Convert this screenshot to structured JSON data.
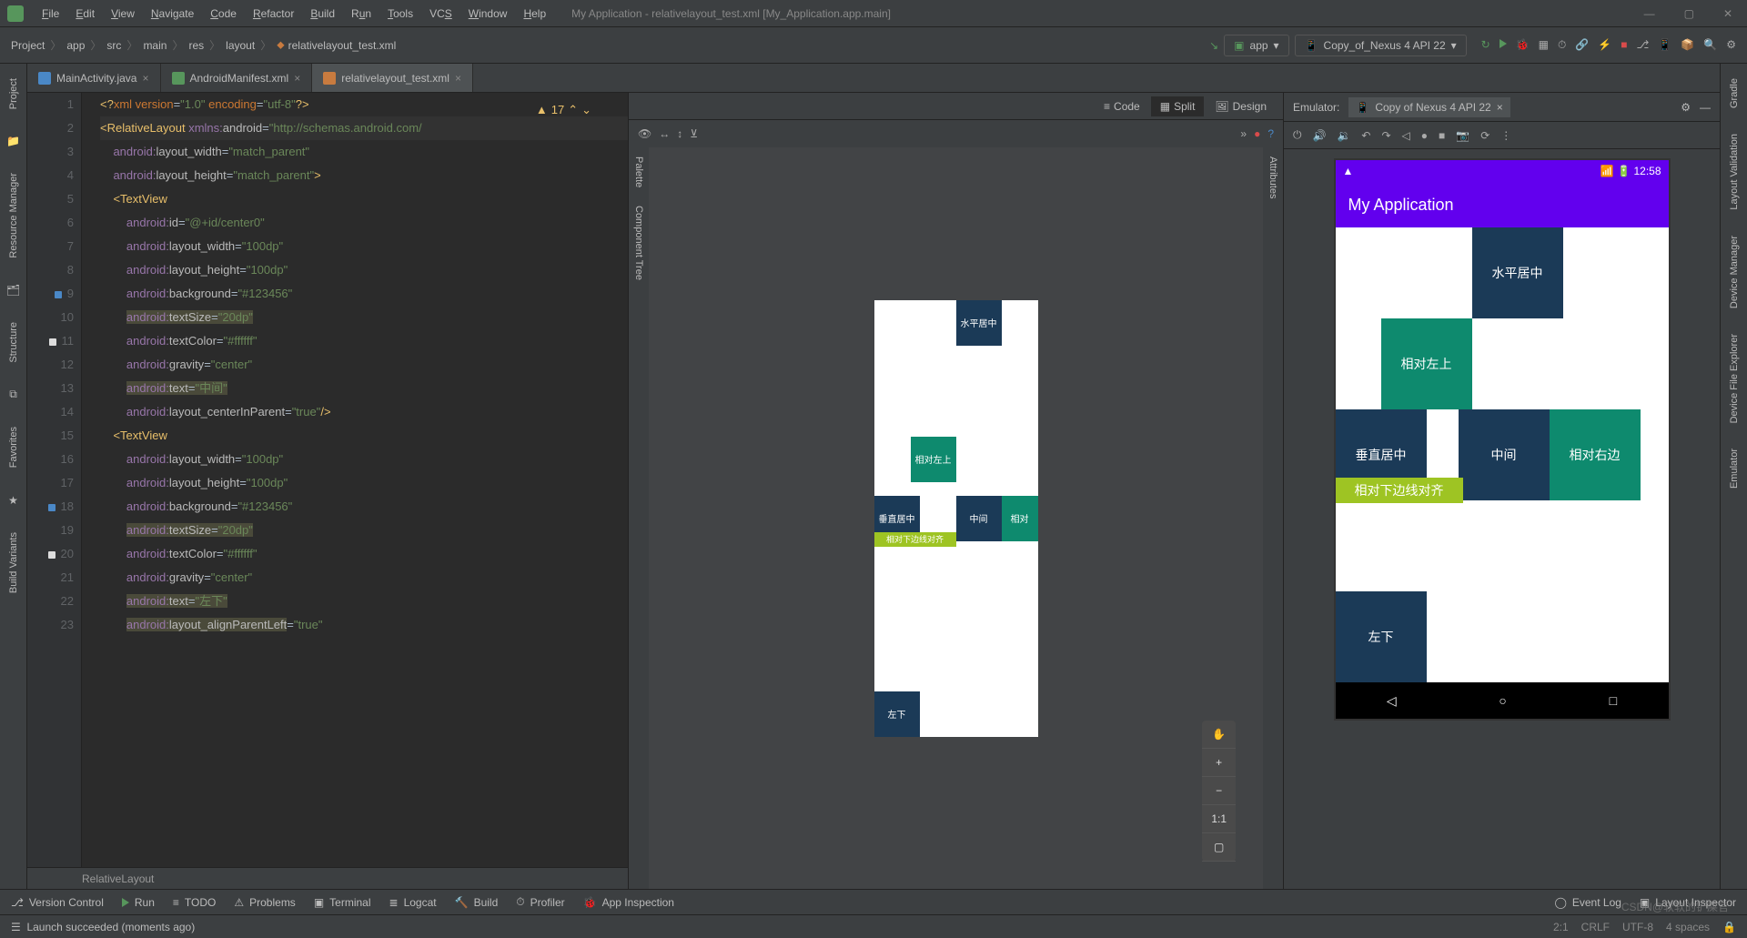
{
  "titlebar": {
    "title": "My Application - relativelayout_test.xml [My_Application.app.main]"
  },
  "menu": {
    "file": "File",
    "edit": "Edit",
    "view": "View",
    "navigate": "Navigate",
    "code": "Code",
    "refactor": "Refactor",
    "build": "Build",
    "run": "Run",
    "tools": "Tools",
    "vcs": "VCS",
    "window": "Window",
    "help": "Help"
  },
  "breadcrumb": {
    "items": [
      "Project",
      "app",
      "src",
      "main",
      "res",
      "layout",
      "relativelayout_test.xml"
    ]
  },
  "run_config": {
    "app": "app",
    "device": "Copy_of_Nexus 4 API 22"
  },
  "left_sidebar": {
    "project": "Project",
    "resource_manager": "Resource Manager",
    "structure": "Structure",
    "favorites": "Favorites",
    "build_variants": "Build Variants"
  },
  "right_sidebar": {
    "gradle": "Gradle",
    "layout_validation": "Layout Validation",
    "device_manager": "Device Manager",
    "device_file_explorer": "Device File Explorer",
    "emulator": "Emulator"
  },
  "tabs": {
    "t0": {
      "label": "MainActivity.java"
    },
    "t1": {
      "label": "AndroidManifest.xml"
    },
    "t2": {
      "label": "relativelayout_test.xml"
    }
  },
  "view_modes": {
    "code": "Code",
    "split": "Split",
    "design": "Design"
  },
  "editor": {
    "warning_count": "17",
    "bottom_crumb": "RelativeLayout",
    "lines": [
      "<?xml version=\"1.0\" encoding=\"utf-8\"?>",
      "<RelativeLayout xmlns:android=\"http://schemas.android.com/",
      "    android:layout_width=\"match_parent\"",
      "    android:layout_height=\"match_parent\">",
      "    <TextView",
      "        android:id=\"@+id/center0\"",
      "        android:layout_width=\"100dp\"",
      "        android:layout_height=\"100dp\"",
      "        android:background=\"#123456\"",
      "        android:textSize=\"20dp\"",
      "        android:textColor=\"#ffffff\"",
      "        android:gravity=\"center\"",
      "        android:text=\"中间\"",
      "        android:layout_centerInParent=\"true\"/>",
      "    <TextView",
      "        android:layout_width=\"100dp\"",
      "        android:layout_height=\"100dp\"",
      "        android:background=\"#123456\"",
      "        android:textSize=\"20dp\"",
      "        android:textColor=\"#ffffff\"",
      "        android:gravity=\"center\"",
      "        android:text=\"左下\"",
      "        android:layout_alignParentLeft=\"true\""
    ]
  },
  "design_sidebar": {
    "palette": "Palette",
    "component_tree": "Component Tree",
    "attributes": "Attributes"
  },
  "preview": {
    "boxes": {
      "hcenter": "水平居中",
      "relTopLeft": "相对左上",
      "vcenter": "垂直居中",
      "center": "中间",
      "relRight": "相对",
      "relBottomAlign": "相对下边线对齐",
      "bottomLeft": "左下"
    }
  },
  "emulator": {
    "label": "Emulator:",
    "tab": "Copy of Nexus 4 API 22",
    "time": "12:58",
    "app_title": "My Application",
    "boxes": {
      "hcenter": "水平居中",
      "relTopLeft": "相对左上",
      "vcenter": "垂直居中",
      "center": "中间",
      "relRight": "相对右边",
      "relBottomAlign": "相对下边线对齐",
      "bottomLeft": "左下"
    }
  },
  "zoom": {
    "oneToOne": "1:1"
  },
  "bottom_toolbar": {
    "version_control": "Version Control",
    "run": "Run",
    "todo": "TODO",
    "problems": "Problems",
    "terminal": "Terminal",
    "logcat": "Logcat",
    "build": "Build",
    "profiler": "Profiler",
    "app_inspection": "App Inspection",
    "event_log": "Event Log",
    "layout_inspector": "Layout Inspector"
  },
  "status": {
    "message": "Launch succeeded (moments ago)",
    "pos": "2:1",
    "eol": "CRLF",
    "enc": "UTF-8",
    "indent": "4 spaces"
  },
  "watermark": "CSDN@软软的铲屎官"
}
